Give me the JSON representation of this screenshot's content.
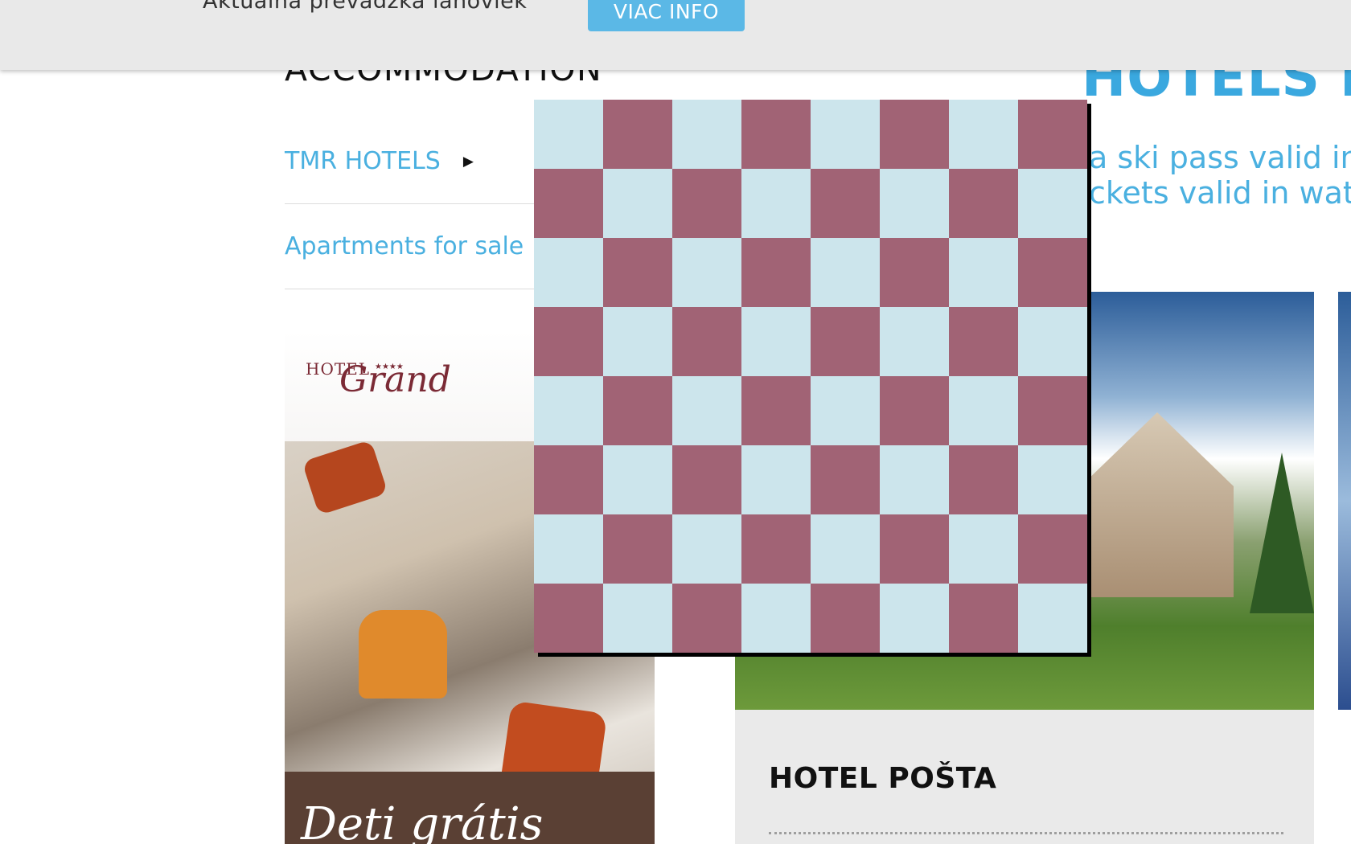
{
  "topbar": {
    "text": "Aktuálna prevádzka lanoviek",
    "button_label": "VIAC INFO"
  },
  "sidebar": {
    "title": "ACCOMMODATION",
    "items": [
      {
        "label": "TMR HOTELS",
        "has_submenu": true
      },
      {
        "label": "Apartments for sale",
        "has_submenu": false
      }
    ]
  },
  "promo": {
    "logo_prefix": "HOTEL",
    "logo_name": "Grand",
    "logo_stars": "★★★★",
    "caption": "Deti grátis"
  },
  "main": {
    "heading": "HOTELS I",
    "line1": "a ski pass valid in",
    "line2": "ckets valid in wat"
  },
  "hotel_card": {
    "name": "HOTEL POŠTA"
  },
  "overlay": {
    "color_a": "#cce5ec",
    "color_b": "#a16375",
    "rows": 8,
    "cols": 8
  },
  "colors": {
    "accent": "#4ab0e0",
    "button": "#5bb8e6",
    "topbar_bg": "#e9e9e9"
  }
}
